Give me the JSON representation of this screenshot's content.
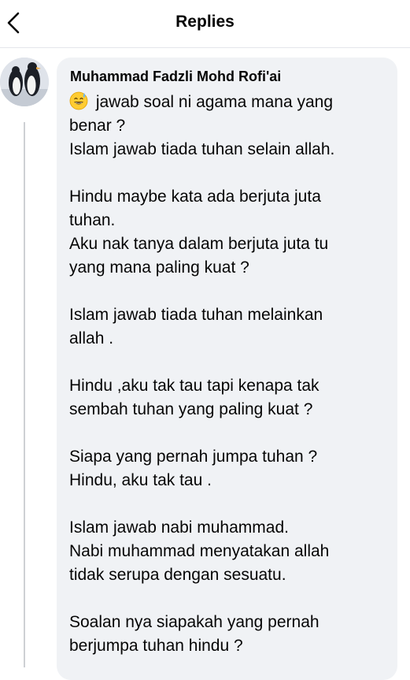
{
  "header": {
    "title": "Replies",
    "back_icon": "chevron-left-icon"
  },
  "comment": {
    "author": "Muhammad Fadzli Mohd Rofi'ai",
    "avatar_icon": "penguin-avatar",
    "emoji_icon": "grinning-sweat-emoji",
    "text": " jawab soal ni agama mana yang\nbenar ?\nIslam jawab tiada tuhan selain allah.\n\nHindu maybe kata ada berjuta juta\ntuhan.\nAku nak tanya dalam berjuta juta tu\nyang mana paling kuat ?\n\nIslam jawab tiada tuhan melainkan\nallah .\n\nHindu ,aku tak tau tapi kenapa tak\nsembah tuhan yang paling kuat ?\n\nSiapa yang pernah jumpa tuhan ?\nHindu, aku tak tau .\n\nIslam jawab nabi muhammad.\nNabi muhammad menyatakan allah\ntidak serupa dengan sesuatu.\n\nSoalan nya siapakah yang pernah\nberjumpa tuhan hindu ?"
  },
  "colors": {
    "bubble": "#f0f2f5",
    "text": "#050505",
    "thread_line": "#ced0d4"
  }
}
